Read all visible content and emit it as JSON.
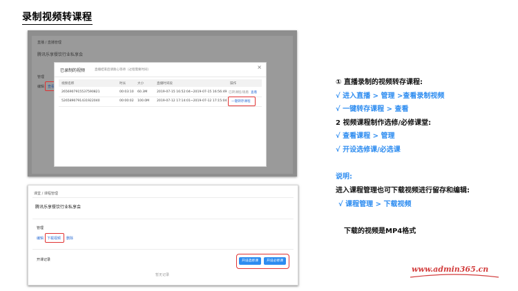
{
  "slide": {
    "title": "录制视频转课程"
  },
  "top_screenshot": {
    "breadcrumb": "直播 / 直播管理",
    "page_heading": "腾讯乐享餐饮行业私享会",
    "section_label": "管理",
    "left_links": [
      "编辑",
      "查看"
    ],
    "modal": {
      "title": "已录制的视频",
      "hint": "直播结束后请耐心等待（过程需要时间）",
      "close": "×",
      "columns": [
        "视频名称",
        "时长",
        "大小",
        "直播时间段",
        "操作"
      ],
      "rows": [
        {
          "name": "2656907915537590821",
          "duration": "00:03:10",
          "size": "60.3M",
          "period": "2019-07-15 16:52:04~2019-07-15 16:56:49",
          "actions": [
            "已转课程/观看",
            "查看"
          ]
        },
        {
          "name": "5265890791431922040",
          "duration": "00:00:02",
          "size": "100.0M",
          "period": "2019-07-12 17:14:01~2019-07-12 17:15:04",
          "actions": [
            "一键转存课程"
          ]
        }
      ]
    }
  },
  "bottom_screenshot": {
    "breadcrumb": "课堂 / 课程管理",
    "page_heading": "腾讯乐享餐饮行业私享会",
    "section_label": "管理",
    "links": [
      "编辑",
      "下载视频",
      "删除"
    ],
    "record_label": "开课记录",
    "empty_text": "暂无记录",
    "buttons": [
      "开设选修课",
      "开设必修课"
    ]
  },
  "instructions": {
    "step1_title": "①   直播录制的视频转存课程:",
    "step1_items": [
      "√  进入直播 > 管理 >查看录制视频",
      "√  一键转存课程 > 查看"
    ],
    "step2_title": "2 视频课程制作选修/必修课堂:",
    "step2_items": [
      "√  查看课程 > 管理",
      "√  开设选修课/必选课"
    ],
    "note_label": "说明:",
    "note_text": "进入课程管理也可下载视频进行留存和编辑:",
    "note_item": "√  课程管理 > 下载视频",
    "format_note": "下载的视频是MP4格式"
  },
  "watermark": "www.admin365.cn",
  "colors": {
    "accent_blue": "#2d8cf0",
    "highlight_red": "#e03030",
    "watermark_red": "#d23c3c"
  }
}
